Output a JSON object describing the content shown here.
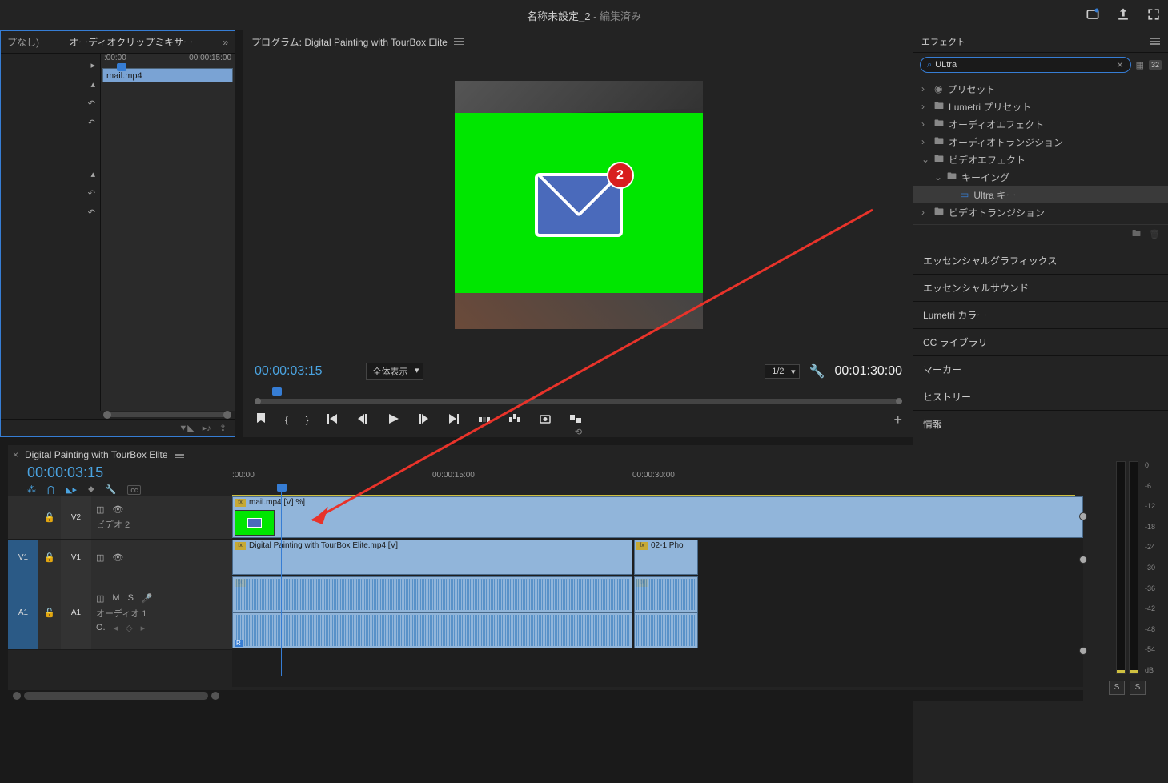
{
  "title": {
    "name": "名称未設定_2",
    "suffix": " - 編集済み"
  },
  "source_panel": {
    "tab_none": "プなし)",
    "tab_mixer": "オーディオクリップミキサー",
    "tc_start": ":00:00",
    "tc_end": "00:00:15:00",
    "clip_name": "mail.mp4"
  },
  "program_panel": {
    "title_prefix": "プログラム: ",
    "title_seq": "Digital Painting with TourBox Elite",
    "tc_current": "00:00:03:15",
    "zoom": "全体表示",
    "res": "1/2",
    "tc_duration": "00:01:30:00",
    "badge_num": "2"
  },
  "timeline": {
    "seq_name": "Digital Painting with TourBox Elite",
    "tc_current": "00:00:03:15",
    "ruler": [
      ":00:00",
      "00:00:15:00",
      "00:00:30:00"
    ],
    "tracks": {
      "v2_label": "V2",
      "v2_name": "ビデオ 2",
      "v1_src": "V1",
      "v1_tgt": "V1",
      "a1_src": "A1",
      "a1_tgt": "A1",
      "a1_name": "オーディオ 1",
      "mute": "M",
      "solo": "S",
      "O": "O."
    },
    "clip_v2": "mail.mp4 [V] %]",
    "clip_v1": "Digital Painting with TourBox Elite.mp4 [V]",
    "clip_v1_2": "02-1 Pho",
    "r_label": "R"
  },
  "meters": {
    "labels": [
      "0",
      "-6",
      "-12",
      "-18",
      "-24",
      "-30",
      "-36",
      "-42",
      "-48",
      "-54",
      "dB"
    ],
    "solo": "S"
  },
  "effects_panel": {
    "title": "エフェクト",
    "search": "ULtra",
    "tree": {
      "presets": "プリセット",
      "lumetri_presets": "Lumetri プリセット",
      "audio_effects": "オーディオエフェクト",
      "audio_trans": "オーディオトランジション",
      "video_effects": "ビデオエフェクト",
      "keying": "キーイング",
      "ultra_key": "Ultra キー",
      "video_trans": "ビデオトランジション"
    }
  },
  "collapsed_panels": [
    "エッセンシャルグラフィックス",
    "エッセンシャルサウンド",
    "Lumetri カラー",
    "CC ライブラリ",
    "マーカー",
    "ヒストリー",
    "情報"
  ]
}
